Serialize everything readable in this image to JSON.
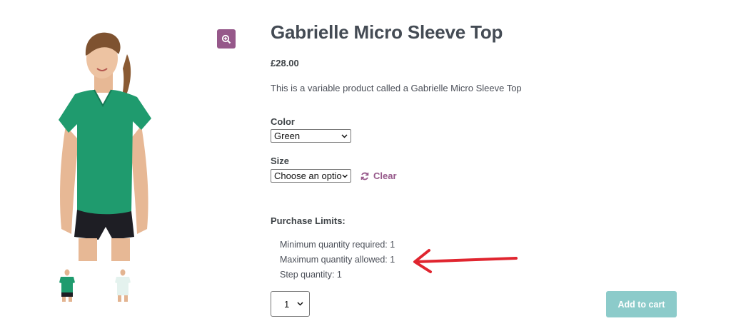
{
  "product": {
    "title": "Gabrielle Micro Sleeve Top",
    "price": "£28.00",
    "description": "This is a variable product called a Gabrielle Micro Sleeve Top"
  },
  "gallery": {
    "main_image_icon": "woman-green-tshirt-image",
    "zoom_icon": "zoom-in-icon",
    "thumbnails": [
      "green-top-thumbnail",
      "white-top-thumbnail"
    ]
  },
  "variations": {
    "color": {
      "label": "Color",
      "selected": "Green"
    },
    "size": {
      "label": "Size",
      "selected": "Choose an option"
    },
    "clear_label": "Clear",
    "clear_icon": "refresh-icon"
  },
  "purchase_limits": {
    "title": "Purchase Limits:",
    "min": "Minimum quantity required: 1",
    "max": "Maximum quantity allowed: 1",
    "step": "Step quantity: 1"
  },
  "annotation": {
    "arrow_icon": "red-arrow-icon",
    "color": "#e0252f"
  },
  "cart": {
    "quantity": "1",
    "add_label": "Add to cart"
  },
  "colors": {
    "accent": "#96588a",
    "button": "#8ccbca",
    "shirt": "#1f9b6e"
  }
}
